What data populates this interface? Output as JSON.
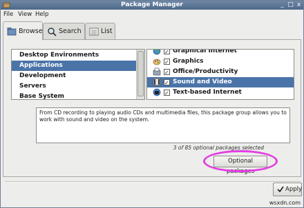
{
  "window": {
    "title": "Package Manager",
    "controls": [
      "_",
      "□",
      "x"
    ]
  },
  "menubar": {
    "items": [
      "File",
      "View",
      "Help"
    ]
  },
  "tabs": [
    {
      "label": "Browse",
      "icon": "browse-icon",
      "active": true
    },
    {
      "label": "Search",
      "icon": "search-icon",
      "active": false
    },
    {
      "label": "List",
      "icon": "list-icon",
      "active": false
    }
  ],
  "categories": {
    "items": [
      "Desktop Environments",
      "Applications",
      "Development",
      "Servers",
      "Base System"
    ],
    "selected": "Applications"
  },
  "groups": {
    "items": [
      {
        "label": "Graphical Internet",
        "icon": "globe-icon",
        "checked": true
      },
      {
        "label": "Graphics",
        "icon": "paint-icon",
        "checked": true
      },
      {
        "label": "Office/Productivity",
        "icon": "office-icon",
        "checked": true
      },
      {
        "label": "Sound and Video",
        "icon": "media-icon",
        "checked": true
      },
      {
        "label": "Text-based Internet",
        "icon": "terminal-icon",
        "checked": true
      }
    ],
    "selected": "Sound and Video"
  },
  "description": {
    "text": "From CD recording to playing audio CDs and multimedia files, this package group allows you to work with sound and video on the system."
  },
  "package_count": "3 of 85 optional packages selected",
  "optional_packages_button": "Optional packages",
  "apply_button": "Apply",
  "watermark": "wsxdn.com",
  "colors": {
    "selection": "#4a74a8",
    "highlight_ring": "#e23ee2",
    "titlebar": "#5a7598"
  }
}
